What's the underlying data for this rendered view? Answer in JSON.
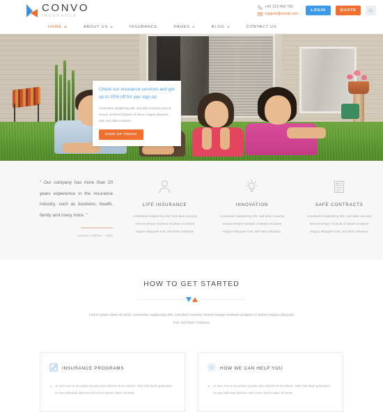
{
  "brand": {
    "name": "CONVO",
    "tagline": "INSURANCE",
    "logo_icon": "convo-arrow-logo",
    "blue": "#3c9ae8",
    "orange": "#f2702f"
  },
  "topbar": {
    "phone": "+49 123 456 789",
    "phone_icon": "phone-icon",
    "email": "support@email.com",
    "email_icon": "envelope-icon",
    "login_label": "LOGIN",
    "quote_label": "QUOTE",
    "search_icon": "search-icon"
  },
  "nav": {
    "items": [
      {
        "label": "HOME",
        "has_caret": true,
        "active": true
      },
      {
        "label": "ABOUT US",
        "has_caret": true,
        "active": false
      },
      {
        "label": "INSURANCE",
        "has_caret": false,
        "active": false
      },
      {
        "label": "PAGES",
        "has_caret": true,
        "active": false
      },
      {
        "label": "BLOG",
        "has_caret": true,
        "active": false
      },
      {
        "label": "CONTACT US",
        "has_caret": false,
        "active": false
      }
    ]
  },
  "hero": {
    "image_description": "Family of four lying on green grass in front of a house",
    "callout": {
      "title": "Check our insurance services and get up to 25% off for you sign up",
      "text": "Consetetur sadipscing elitr, sed diam nonumy eirmod tempor invidunt ut labore et dolore magna aliquyam erat, sed diam voluptua.",
      "button_label": "SIGN UP TODAY"
    }
  },
  "services": {
    "testimonial": {
      "quote": "\" Our company has more than 20 years experience in the insurance industry, such as business, health, family and many more. \"",
      "author": "Jackson Vaillant - CEO"
    },
    "columns": [
      {
        "icon": "person-icon",
        "title": "LIFE INSURANCE",
        "text": "Consetetur sadipscing elitr, sed diam nonumy eirmod tempor invidunt ut labore et dolore magna aliquyam erat, sed diam voluptua."
      },
      {
        "icon": "lightbulb-icon",
        "title": "INNOVATION",
        "text": "Consetetur sadipscing elitr, sed diam nonumy eirmod tempor invidunt ut labore et dolore magna aliquyam erat, sed diam voluptua."
      },
      {
        "icon": "document-icon",
        "title": "SAFE CONTRACTS",
        "text": "Consetetur sadipscing elitr, sed diam nonumy eirmod tempor invidunt ut labore et dolore magna aliquyam erat, sed diam voluptua."
      }
    ]
  },
  "started": {
    "title": "HOW TO GET STARTED",
    "divider_icon": "triangle-pair-divider",
    "text": "Lorem ipsum dolor sit amet, consetetur sadipscing elitr, sed diam nonumy eirmod tempor invidunt ut labore et dolore magna aliquyam erat, sed diam voluptua."
  },
  "cards": [
    {
      "icon": "pencil-square-icon",
      "title": "INSURANCE PROGRAMS",
      "items": [
        "At vero eos et accusam et justo duo dolores et ea rebum. Stet clita kasd gubergren no sea takimata sanctus est Lorem ipsum dolor sit amet."
      ]
    },
    {
      "icon": "gear-icon",
      "title": "HOW WE CAN HELP YOU",
      "items": [
        "At vero eos et accusam et justo duo dolores et ea rebum. Stet clita kasd gubergren no sea takimata sanctus est Lorem ipsum dolor sit amet."
      ]
    }
  ]
}
